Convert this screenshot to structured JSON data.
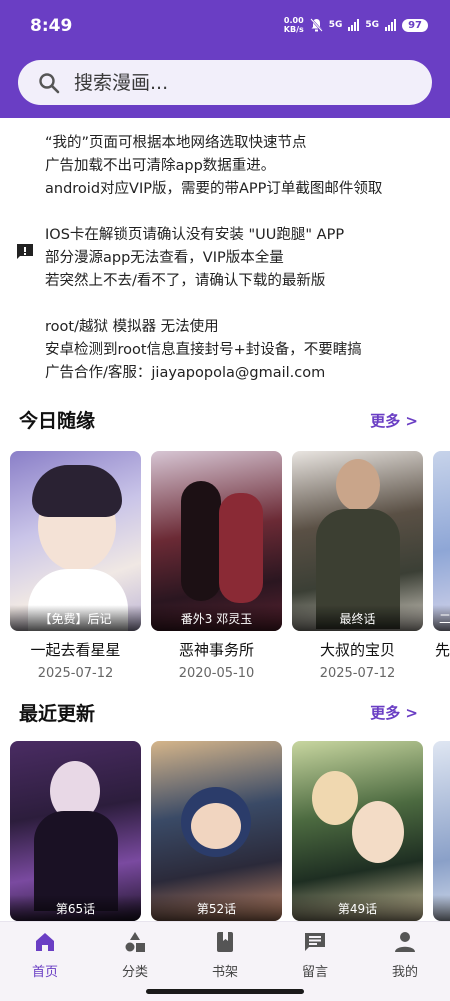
{
  "status_bar": {
    "time": "8:49",
    "speed_top": "0.00",
    "speed_bottom": "KB/s",
    "net1": "5G",
    "net2": "5G",
    "battery": "97"
  },
  "search": {
    "placeholder": "搜索漫画..."
  },
  "notice": {
    "lines": [
      "“我的”页面可根据本地网络选取快速节点",
      "广告加载不出可清除app数据重进。",
      "android对应VIP版，需要的带APP订单截图邮件领取",
      "",
      "IOS卡在解锁页请确认没有安装 \"UU跑腿\" APP",
      "部分漫源app无法查看，VIP版本全量",
      "若突然上不去/看不了，请确认下载的最新版",
      "",
      "root/越狱 模拟器 无法使用",
      "安卓检测到root信息直接封号+封设备，不要瞎搞",
      "广告合作/客服：jiayapopola@gmail.com"
    ]
  },
  "today": {
    "title": "今日随缘",
    "more": "更多 >",
    "items": [
      {
        "badge": "【免费】后记",
        "title": "一起去看星星",
        "date": "2025-07-12"
      },
      {
        "badge": "番外3 邓灵玉",
        "title": "恶神事务所",
        "date": "2020-05-10"
      },
      {
        "badge": "最终话",
        "title": "大叔的宝贝",
        "date": "2025-07-12"
      },
      {
        "badge": "二",
        "title": "先",
        "date": ""
      }
    ]
  },
  "recent": {
    "title": "最近更新",
    "more": "更多 >",
    "items": [
      {
        "badge": "第65话"
      },
      {
        "badge": "第52话"
      },
      {
        "badge": "第49话"
      },
      {
        "badge": ""
      }
    ]
  },
  "nav": {
    "items": [
      {
        "label": "首页",
        "icon": "home-icon",
        "active": true
      },
      {
        "label": "分类",
        "icon": "category-icon"
      },
      {
        "label": "书架",
        "icon": "bookshelf-icon"
      },
      {
        "label": "留言",
        "icon": "message-icon"
      },
      {
        "label": "我的",
        "icon": "profile-icon"
      }
    ]
  },
  "colors": {
    "brand": "#6a3ec4",
    "search_bg": "#f2effa",
    "nav_bg": "#f6f3f8"
  }
}
